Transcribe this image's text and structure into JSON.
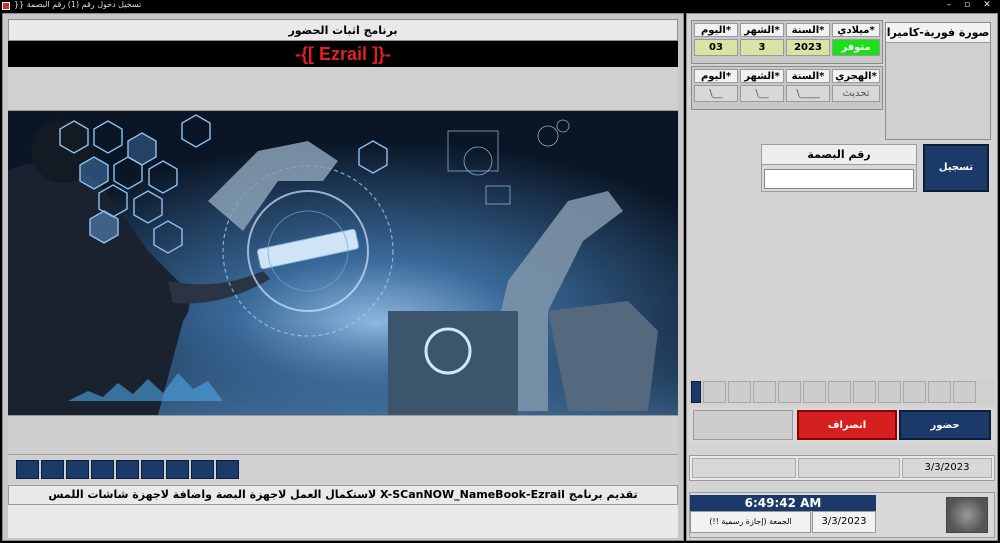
{
  "window": {
    "title": "تسجيل دخول رقم (1) رقم البصمة {{"
  },
  "app": {
    "program_title": "برنامج اثبات الحضور",
    "banner": "-{[ Ezrail ]}-",
    "footer_message": "تقديم برنامج X-SCanNOW_NameBook-Ezrail لاستكمال العمل لاجهزة البصة واضافة لاجهزة شاشات اللمس"
  },
  "date_gregorian": {
    "type_label": "*ميلادي",
    "type_value": "متوفر",
    "year_label": "*السنة",
    "year_value": "2023",
    "month_label": "*الشهر",
    "month_value": "3",
    "day_label": "*اليوم",
    "day_value": "03"
  },
  "date_hijri": {
    "type_label": "*الهجري",
    "type_value": "تحديث",
    "year_label": "*السنة",
    "year_value": "____\\",
    "month_label": "*الشهر",
    "month_value": "__\\",
    "day_label": "*اليوم",
    "day_value": "__\\"
  },
  "camera": {
    "title": "صورة فورية-كاميرا"
  },
  "fingerprint": {
    "label": "رقم البصمة",
    "value": "",
    "register_label": "تسجيل"
  },
  "actions": {
    "attend_label": "حضور",
    "leave_label": "انصراف",
    "blank_label": ""
  },
  "status": {
    "date": "3/3/2023"
  },
  "clock": {
    "time": "6:49:42 AM",
    "date": "3/3/2023",
    "day_text": "الجمعة (إجازة رسمية !!)"
  },
  "colors": {
    "navy": "#1b3a6a",
    "banner_red": "#e0201f",
    "leave_red": "#d62020",
    "available_green": "#19e019",
    "olive": "#d6e4a4"
  }
}
